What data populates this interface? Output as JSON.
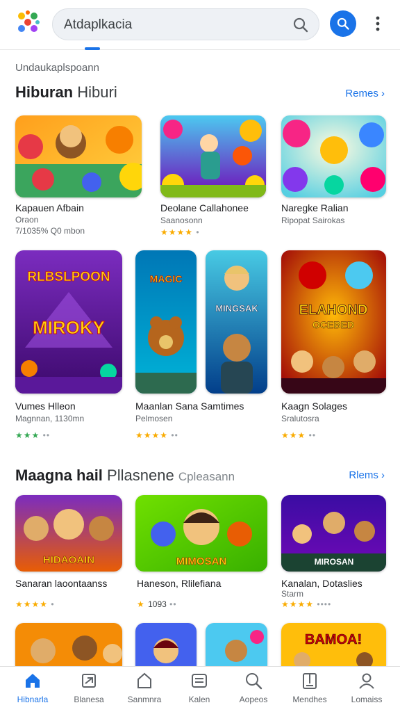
{
  "header": {
    "search_text": "Atdaplkacia",
    "accent": "#1a73e8"
  },
  "main": {
    "subtitle": "Undaukaplspoann",
    "sections": [
      {
        "title_bold": "Hiburan",
        "title_light": "Hiburi",
        "title_extra": "",
        "see_more": "Remes ›"
      },
      {
        "title_bold": "Maagna hail",
        "title_light": "Pllasnene",
        "title_extra": "Cpleasann",
        "see_more": "Rlems ›"
      }
    ],
    "cards": [
      {
        "title": "Kapauen Afbain",
        "sub": "Oraon",
        "extra": "7/1035% Q0 mbon",
        "stars": ""
      },
      {
        "title": "Deolane Callahonee",
        "sub": "Saanosonn",
        "extra": "",
        "stars": "★★★★"
      },
      {
        "title": "Naregke Ralian",
        "sub": "Ripopat Sairokas",
        "extra": "",
        "stars": ""
      },
      {
        "title": "Vumes Hlleon",
        "sub": "Magnnan, 1130mn",
        "extra": "",
        "stars": "★★★"
      },
      {
        "title": "Maanlan Sana Samtimes",
        "sub": "Pelmosen",
        "extra": "",
        "stars": "★★★★"
      },
      {
        "title": "Kaagn Solages",
        "sub": "Sralutosra",
        "extra": "",
        "stars": "★★★"
      },
      {
        "title": "Sanaran laoontaanss",
        "sub": "",
        "extra": "",
        "stars": "★★★★"
      },
      {
        "title": "Haneson, Rlilefiana",
        "sub": "",
        "extra": "1093",
        "stars": "★"
      },
      {
        "title": "Kanalan, Dotaslies",
        "sub": "Starm",
        "extra": "",
        "stars": "★★★★"
      }
    ]
  },
  "tiles": {
    "t4": "RLBSLPOON",
    "t4b": "MIROKY",
    "t5": "MAGIC",
    "t6": "MINGSAK",
    "t7": "ELAHOND",
    "t7b": "OCEBED",
    "t8": "HIDAOAIN",
    "t9": "MIMOSAN",
    "t10": "MIROSAN",
    "t14": "BAMOA!"
  },
  "bottom_nav": [
    {
      "label": "Hibnarla",
      "icon": "home-icon"
    },
    {
      "label": "Blanesa",
      "icon": "games-icon"
    },
    {
      "label": "Sanmnra",
      "icon": "apps-icon"
    },
    {
      "label": "Kalen",
      "icon": "books-icon"
    },
    {
      "label": "Aopeos",
      "icon": "search-icon"
    },
    {
      "label": "Mendhes",
      "icon": "library-icon"
    },
    {
      "label": "Lomaiss",
      "icon": "account-icon"
    }
  ]
}
